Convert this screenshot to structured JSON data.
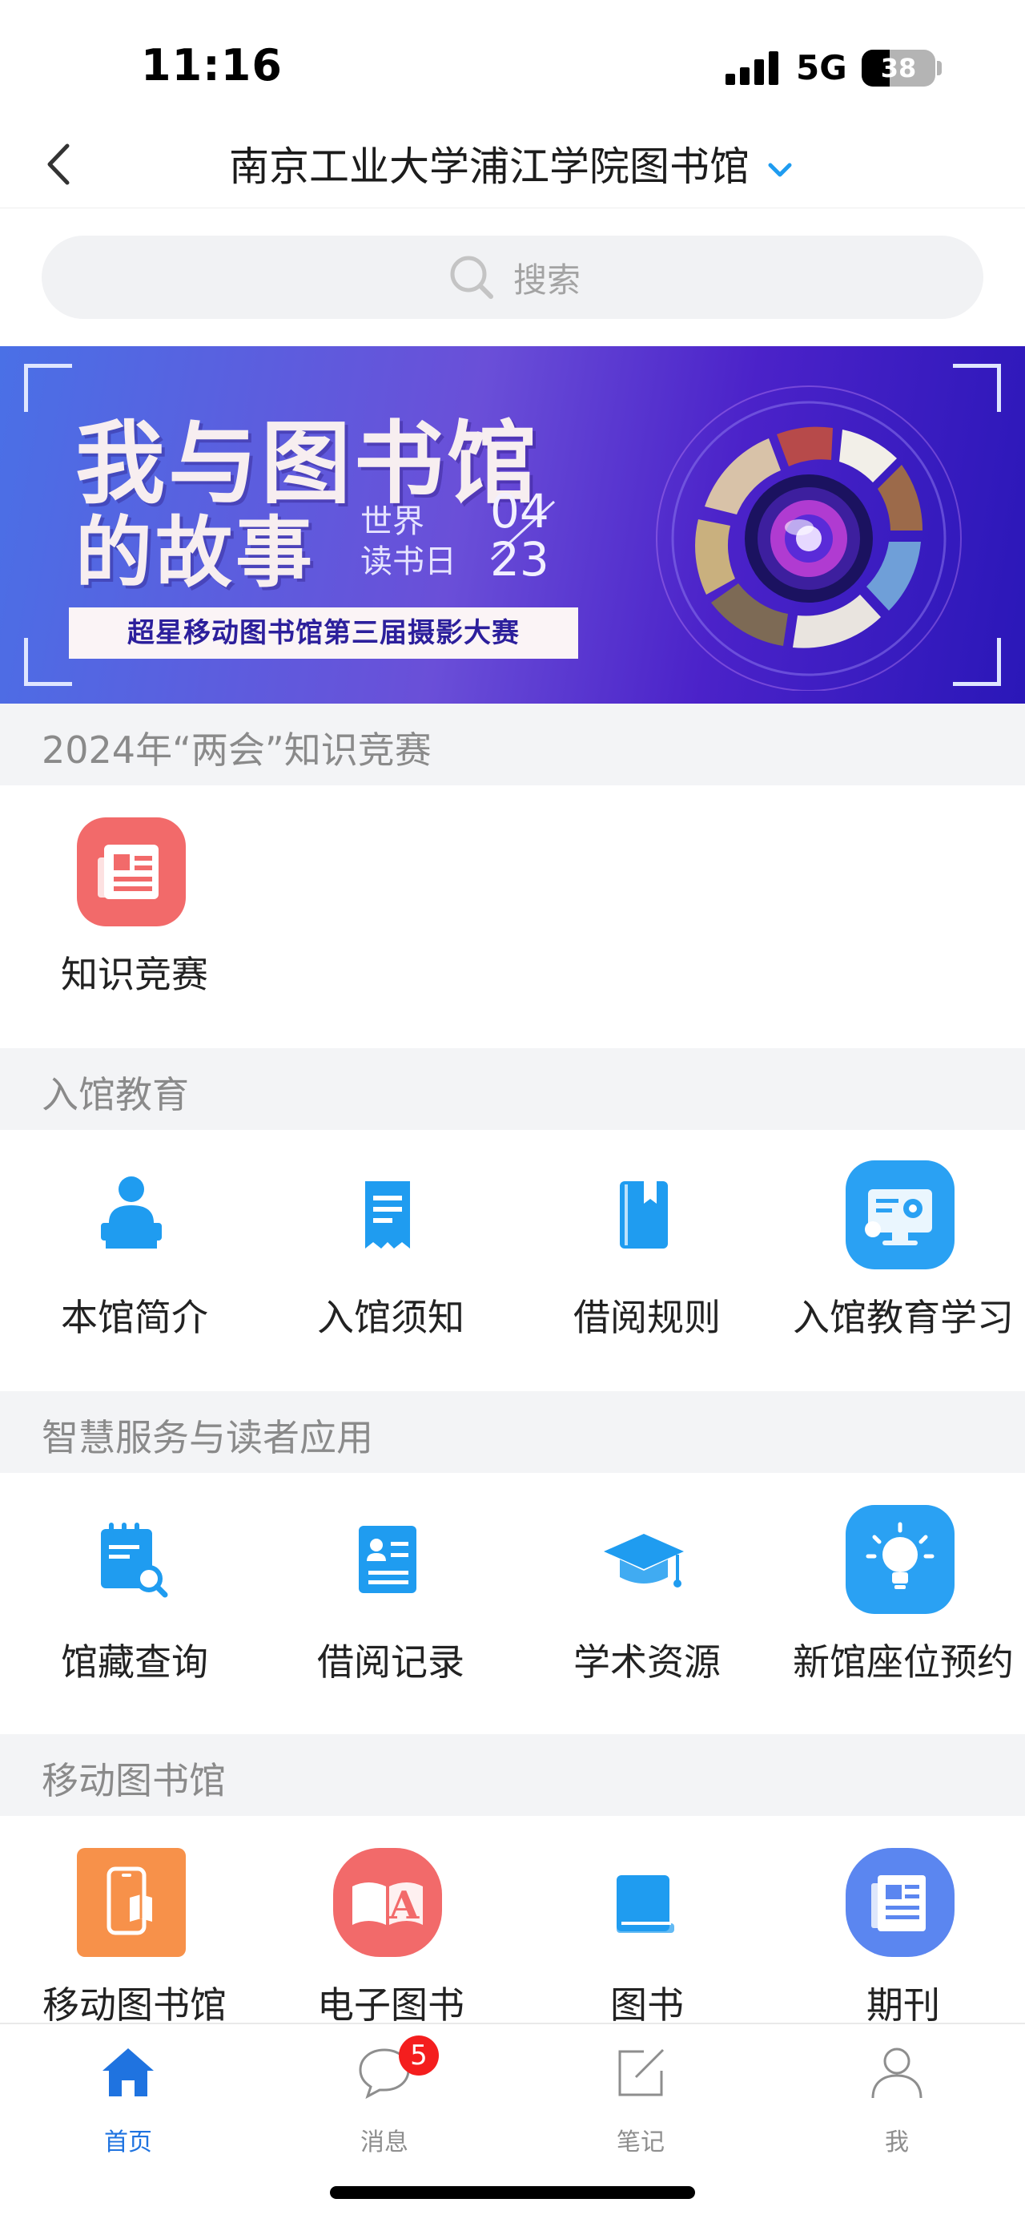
{
  "status_bar": {
    "time": "11:16",
    "network": "5G",
    "battery": "38",
    "battery_level": 0.38
  },
  "nav": {
    "title": "南京工业大学浦江学院图书馆"
  },
  "search": {
    "placeholder": "搜索"
  },
  "banner": {
    "title_line1": "我与图书馆",
    "title_line2": "的故事",
    "subtitle_line1": "世界",
    "subtitle_line2": "读书日",
    "date_month": "04",
    "date_day": "23",
    "tagline": "超星移动图书馆第三届摄影大赛"
  },
  "sections": [
    {
      "title": "2024年“两会”知识竞赛",
      "items": [
        {
          "label": "知识竞赛",
          "icon": "newspaper-icon",
          "color": "#f26a6a"
        }
      ]
    },
    {
      "title": "入馆教育",
      "items": [
        {
          "label": "本馆简介",
          "icon": "librarian-icon",
          "color": "#1f9cf0"
        },
        {
          "label": "入馆须知",
          "icon": "notice-icon",
          "color": "#1f9cf0"
        },
        {
          "label": "借阅规则",
          "icon": "bookmark-book-icon",
          "color": "#1f9cf0"
        },
        {
          "label": "入馆教育学习",
          "icon": "monitor-settings-icon",
          "color": "#2aa1f3"
        }
      ]
    },
    {
      "title": "智慧服务与读者应用",
      "items": [
        {
          "label": "馆藏查询",
          "icon": "calendar-search-icon",
          "color": "#1f9cf0"
        },
        {
          "label": "借阅记录",
          "icon": "id-card-icon",
          "color": "#1f9cf0"
        },
        {
          "label": "学术资源",
          "icon": "graduation-cap-icon",
          "color": "#1f9cf0"
        },
        {
          "label": "新馆座位预约",
          "icon": "lightbulb-icon",
          "color": "#2aa1f3"
        }
      ]
    },
    {
      "title": "移动图书馆",
      "items": [
        {
          "label": "移动图书馆",
          "icon": "mobile-book-icon",
          "color": "#f7914a"
        },
        {
          "label": "电子图书",
          "icon": "ebook-icon",
          "color": "#f26a6a"
        },
        {
          "label": "图书",
          "icon": "book-icon",
          "color": "#1f9cf0"
        },
        {
          "label": "期刊",
          "icon": "journal-icon",
          "color": "#5b86f0"
        }
      ]
    }
  ],
  "tabs": [
    {
      "label": "首页",
      "icon": "home-icon",
      "active": true
    },
    {
      "label": "消息",
      "icon": "message-icon",
      "badge": "5"
    },
    {
      "label": "笔记",
      "icon": "note-edit-icon"
    },
    {
      "label": "我",
      "icon": "user-icon"
    }
  ],
  "colors": {
    "accent": "#1f73e0",
    "badge": "#f41e1e",
    "section_bg": "#f3f4f6"
  }
}
